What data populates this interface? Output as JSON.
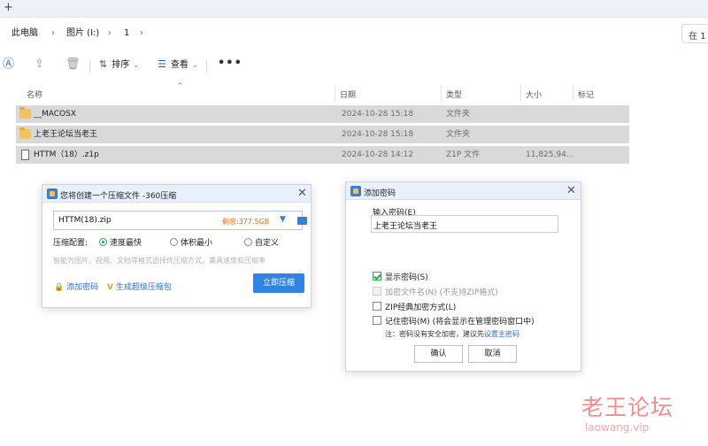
{
  "titlebar": {
    "new_tab": "+"
  },
  "address": {
    "crumbs": [
      "此电脑",
      "图片 (I:)",
      "1"
    ],
    "search_text": "在 1"
  },
  "toolbar": {
    "sort_label": "排序",
    "view_label": "查看",
    "more_label": "•••"
  },
  "columns": {
    "name": "名称",
    "date": "日期",
    "type": "类型",
    "size": "大小",
    "tags": "标记"
  },
  "files": [
    {
      "name": "__MACOSX",
      "date": "2024-10-28 15:18",
      "type": "文件夹",
      "size": "",
      "icon": "folder-icon"
    },
    {
      "name": "上老王论坛当老王",
      "date": "2024-10-28 15:18",
      "type": "文件夹",
      "size": "",
      "icon": "folder-icon"
    },
    {
      "name": "HTTM（18）.z1p",
      "date": "2024-10-28 14:12",
      "type": "Z1P 文件",
      "size": "11,825,94...",
      "icon": "file-icon"
    }
  ],
  "compress_dialog": {
    "title": "您将创建一个压缩文件 -360压缩",
    "filename": "HTTM(18).zip",
    "free_space": "剩余:377.5GB",
    "config_label": "压缩配置:",
    "options": [
      {
        "label": "速度最快",
        "selected": true
      },
      {
        "label": "体积最小",
        "selected": false
      },
      {
        "label": "自定义",
        "selected": false
      }
    ],
    "hint": "智能为图片、视频、文档等格式选择优压缩方式，兼具速度和压缩率",
    "add_password": "添加密码",
    "super_pack": "生成超级压缩包",
    "start_button": "立即压缩"
  },
  "password_dialog": {
    "title": "添加密码",
    "input_label": "输入密码(E)",
    "password_value": "上老王论坛当老王",
    "checkboxes": [
      {
        "label": "显示密码(S)",
        "checked": true,
        "disabled": false
      },
      {
        "label": "加密文件名(N) (不支持ZIP格式)",
        "checked": false,
        "disabled": true
      },
      {
        "label": "ZIP经典加密方式(L)",
        "checked": false,
        "disabled": false
      },
      {
        "label": "记住密码(M) (将会显示在管理密码窗口中)",
        "checked": false,
        "disabled": false
      }
    ],
    "note_prefix": "注：密码没有安全加密，建议先",
    "note_link": "设置主密码",
    "ok": "确认",
    "cancel": "取消"
  },
  "watermark": {
    "cn": "老王论坛",
    "en": "laowang.vip"
  },
  "colors": {
    "accent": "#2f84e6",
    "selected_row": "#d9d9d9",
    "success": "#2ea84f",
    "warning_text": "#e36b1b",
    "watermark": "#f18e8e"
  }
}
